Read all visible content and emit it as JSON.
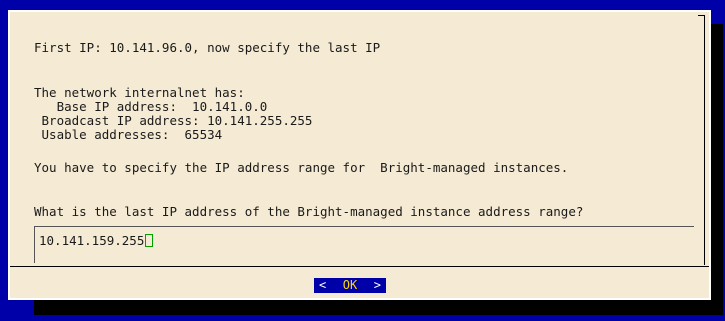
{
  "dialog": {
    "message": "First IP: 10.141.96.0, now specify the last IP",
    "network_intro": "The network internalnet has:",
    "base_ip": "   Base IP address:  10.141.0.0",
    "broadcast_ip": " Broadcast IP address: 10.141.255.255",
    "usable": " Usable addresses:  65534",
    "range_note": "You have to specify the IP address range for  Bright-managed instances.",
    "question": "What is the last IP address of the Bright-managed instance address range?"
  },
  "input": {
    "value": "10.141.159.255"
  },
  "button": {
    "left_arrow": "<",
    "label": "OK",
    "right_arrow": ">"
  },
  "colors": {
    "background": "#0000a8",
    "dialog": "#f5ead3",
    "cursor": "#00a000",
    "button_label": "#ffd700"
  }
}
